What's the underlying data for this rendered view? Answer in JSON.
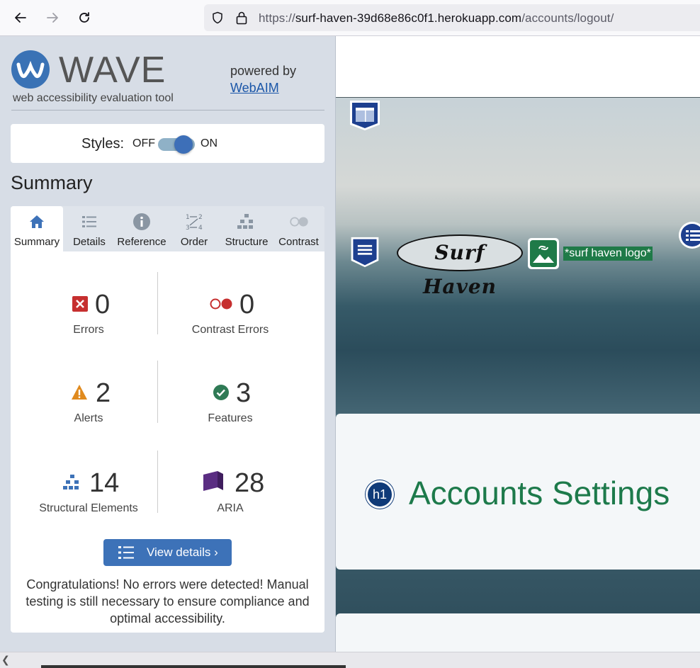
{
  "browser": {
    "url_prefix": "https://",
    "url_domain": "surf-haven-39d68e86c0f1.herokuapp.com",
    "url_path": "/accounts/logout/"
  },
  "wave": {
    "title": "WAVE",
    "subtitle": "web accessibility evaluation tool",
    "powered_by": "powered by",
    "webaim": "WebAIM",
    "styles_label": "Styles:",
    "styles_off": "OFF",
    "styles_on": "ON",
    "styles_state": "on",
    "summary_heading": "Summary",
    "tabs": [
      {
        "label": "Summary",
        "icon": "home-icon",
        "active": true
      },
      {
        "label": "Details",
        "icon": "list-icon",
        "active": false
      },
      {
        "label": "Reference",
        "icon": "info-icon",
        "active": false
      },
      {
        "label": "Order",
        "icon": "order-icon",
        "active": false
      },
      {
        "label": "Structure",
        "icon": "structure-icon",
        "active": false
      },
      {
        "label": "Contrast",
        "icon": "contrast-icon",
        "active": false
      }
    ],
    "stats": {
      "errors": {
        "value": "0",
        "label": "Errors"
      },
      "contrast": {
        "value": "0",
        "label": "Contrast Errors"
      },
      "alerts": {
        "value": "2",
        "label": "Alerts"
      },
      "features": {
        "value": "3",
        "label": "Features"
      },
      "structural": {
        "value": "14",
        "label": "Structural Elements"
      },
      "aria": {
        "value": "28",
        "label": "ARIA"
      }
    },
    "view_details": "View details ›",
    "congrats": "Congratulations! No errors were detected! Manual testing is still necessary to ensure compliance and optimal accessibility."
  },
  "page": {
    "logo_text": "Surf Haven",
    "alt_text": "*surf haven logo*",
    "h1_badge": "h1",
    "heading": "Accounts Settings"
  },
  "colors": {
    "wave_blue": "#3d72b8",
    "error_red": "#c62f2f",
    "alert_orange": "#e08a1e",
    "feature_green": "#2f7a55",
    "aria_purple": "#5a2d82",
    "heading_green": "#1d7a4b"
  }
}
